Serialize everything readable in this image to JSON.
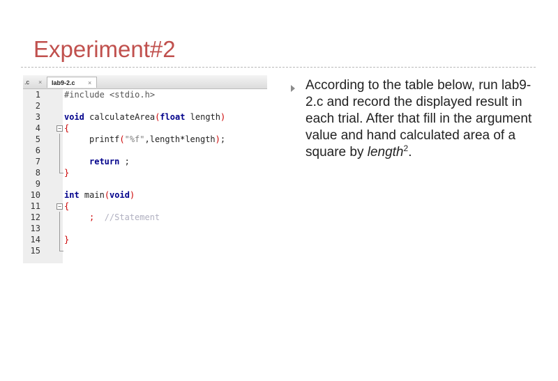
{
  "slide": {
    "title": "Experiment#2"
  },
  "editor": {
    "tabs": [
      {
        "label": ".c",
        "close": "×"
      },
      {
        "label": "lab9-2.c",
        "close": "×"
      }
    ],
    "lines": [
      {
        "n": "1",
        "text": "#include <stdio.h>"
      },
      {
        "n": "2",
        "text": ""
      },
      {
        "n": "3",
        "text": "void calculateArea(float length)"
      },
      {
        "n": "4",
        "text": "{"
      },
      {
        "n": "5",
        "text": "printf(\"%f\",length*length);"
      },
      {
        "n": "6",
        "text": ""
      },
      {
        "n": "7",
        "text": "return ;"
      },
      {
        "n": "8",
        "text": "}"
      },
      {
        "n": "9",
        "text": ""
      },
      {
        "n": "10",
        "text": "int main(void)"
      },
      {
        "n": "11",
        "text": "{"
      },
      {
        "n": "12",
        "text": ";  //Statement"
      },
      {
        "n": "13",
        "text": ""
      },
      {
        "n": "14",
        "text": "}"
      },
      {
        "n": "15",
        "text": ""
      }
    ]
  },
  "instructions": {
    "text_before": "According to the table below, run lab9-2.c and record the displayed result in each trial. After that fill in the argument value and hand calculated area of a square by ",
    "italic": "length",
    "superscript": "2",
    "text_after": "."
  }
}
